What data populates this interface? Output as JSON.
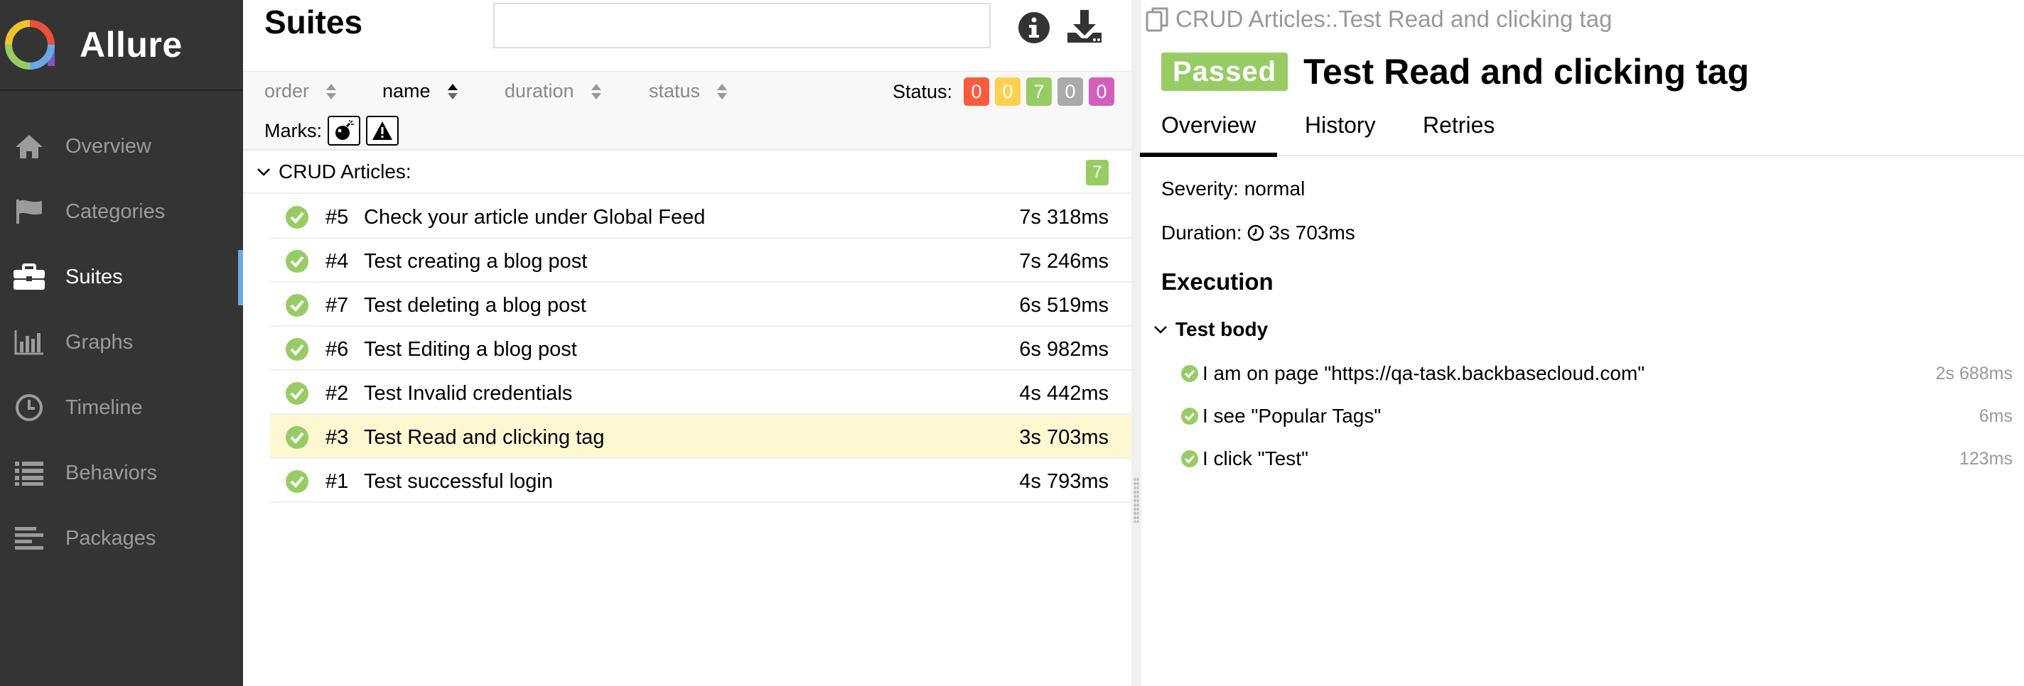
{
  "brand": {
    "name": "Allure"
  },
  "sidebar": {
    "items": [
      {
        "label": "Overview",
        "icon": "home-icon",
        "active": false
      },
      {
        "label": "Categories",
        "icon": "flag-icon",
        "active": false
      },
      {
        "label": "Suites",
        "icon": "briefcase-icon",
        "active": true
      },
      {
        "label": "Graphs",
        "icon": "bar-chart-icon",
        "active": false
      },
      {
        "label": "Timeline",
        "icon": "clock-icon",
        "active": false
      },
      {
        "label": "Behaviors",
        "icon": "list-icon",
        "active": false
      },
      {
        "label": "Packages",
        "icon": "align-left-icon",
        "active": false
      }
    ]
  },
  "suites": {
    "title": "Suites",
    "search": {
      "value": "",
      "placeholder": ""
    },
    "sort": {
      "order_label": "order",
      "name_label": "name",
      "duration_label": "duration",
      "status_label": "status",
      "active": "name"
    },
    "status_filter": {
      "label": "Status:",
      "counts": [
        {
          "status": "failed",
          "value": "0",
          "color": "#fd5a3e"
        },
        {
          "status": "broken",
          "value": "0",
          "color": "#ffd050"
        },
        {
          "status": "passed",
          "value": "7",
          "color": "#97cc64"
        },
        {
          "status": "skipped",
          "value": "0",
          "color": "#aaaaaa"
        },
        {
          "status": "unknown",
          "value": "0",
          "color": "#d35ebe"
        }
      ]
    },
    "marks": {
      "label": "Marks:"
    },
    "group": {
      "name": "CRUD Articles:",
      "count": "7"
    },
    "tests": [
      {
        "num": "#5",
        "name": "Check your article under Global Feed",
        "duration": "7s 318ms",
        "selected": false
      },
      {
        "num": "#4",
        "name": "Test creating a blog post",
        "duration": "7s 246ms",
        "selected": false
      },
      {
        "num": "#7",
        "name": "Test deleting a blog post",
        "duration": "6s 519ms",
        "selected": false
      },
      {
        "num": "#6",
        "name": "Test Editing a blog post",
        "duration": "6s 982ms",
        "selected": false
      },
      {
        "num": "#2",
        "name": "Test Invalid credentials",
        "duration": "4s 442ms",
        "selected": false
      },
      {
        "num": "#3",
        "name": "Test Read and clicking tag",
        "duration": "3s 703ms",
        "selected": true
      },
      {
        "num": "#1",
        "name": "Test successful login",
        "duration": "4s 793ms",
        "selected": false
      }
    ]
  },
  "detail": {
    "breadcrumb": "CRUD Articles:.Test Read and clicking tag",
    "status": "Passed",
    "status_color": "#97cc64",
    "title": "Test Read and clicking tag",
    "tabs": [
      {
        "label": "Overview",
        "active": true
      },
      {
        "label": "History",
        "active": false
      },
      {
        "label": "Retries",
        "active": false
      }
    ],
    "severity_label": "Severity: normal",
    "duration_prefix": "Duration:",
    "duration_value": "3s 703ms",
    "execution_title": "Execution",
    "body_label": "Test body",
    "steps": [
      {
        "name": "I am on page \"https://qa-task.backbasecloud.com\"",
        "duration": "2s 688ms"
      },
      {
        "name": "I see \"Popular Tags\"",
        "duration": "6ms"
      },
      {
        "name": "I click \"Test\"",
        "duration": "123ms"
      }
    ]
  }
}
